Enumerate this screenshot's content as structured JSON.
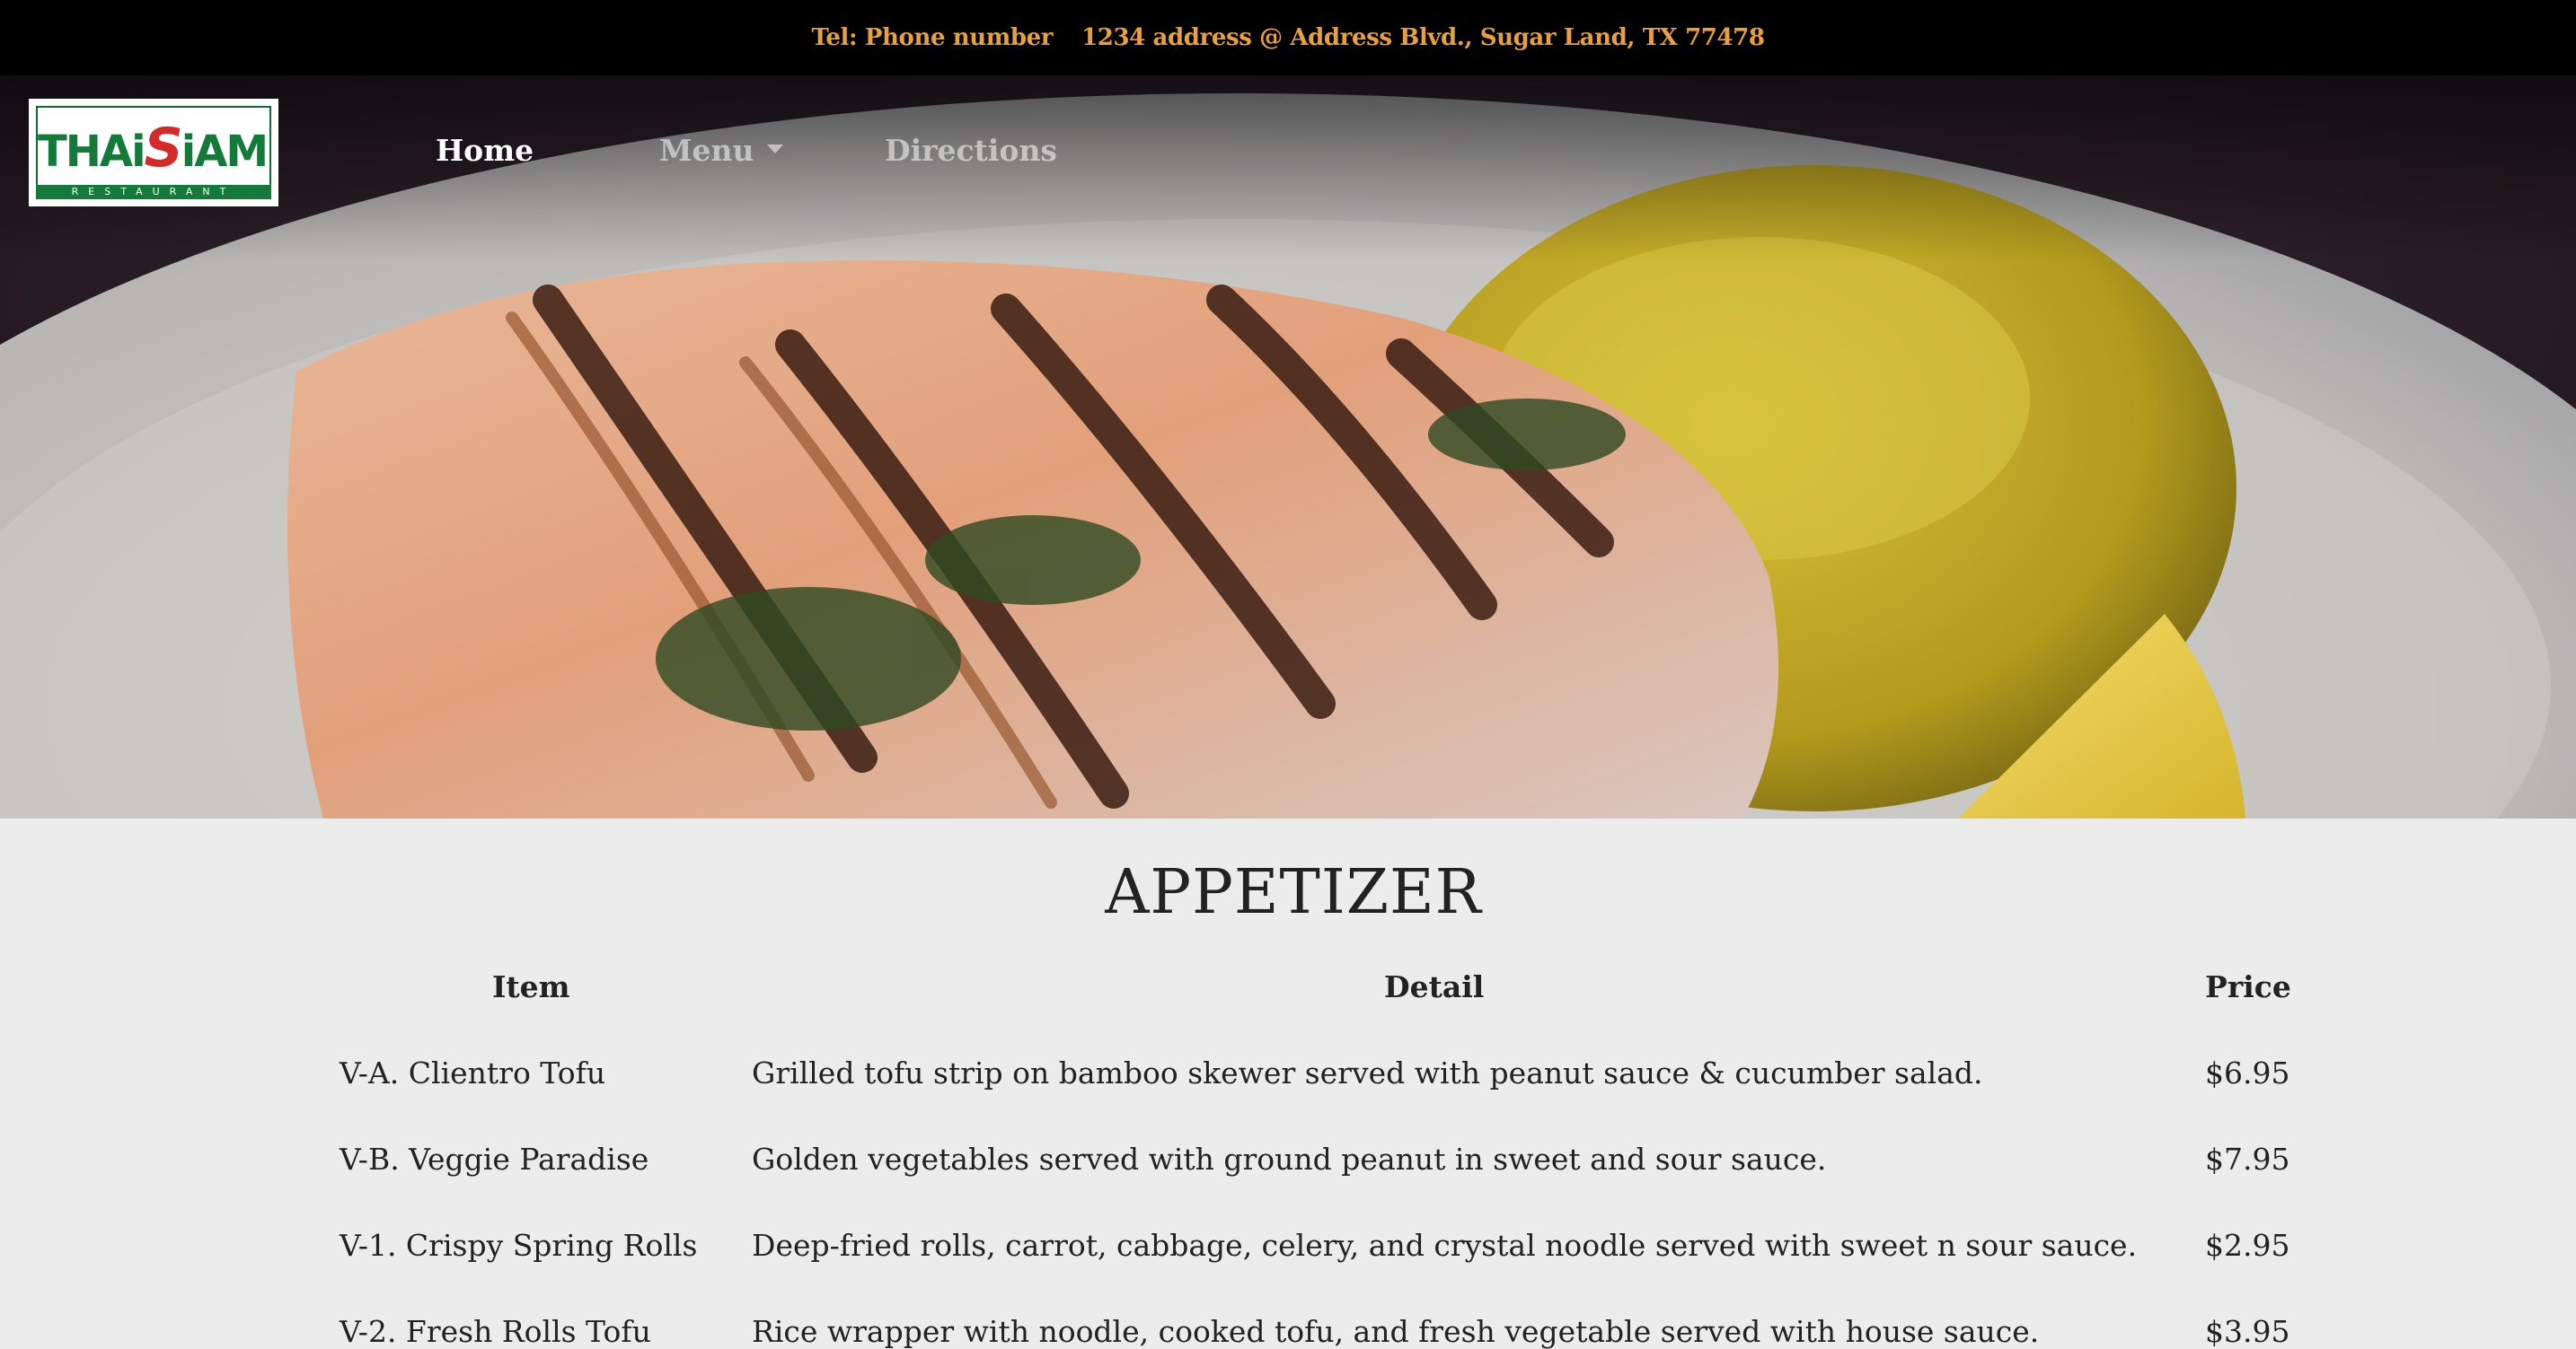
{
  "topbar": {
    "tel": "Tel: Phone number",
    "address": "1234 address @ Address Blvd., Sugar Land, TX 77478"
  },
  "nav": {
    "logo_word_left": "THAi",
    "logo_word_s": "S",
    "logo_word_right": "iAM",
    "logo_sub": "RESTAURANT",
    "home": "Home",
    "menu": "Menu",
    "directions": "Directions"
  },
  "section": {
    "title": "APPETIZER",
    "headers": {
      "item": "Item",
      "detail": "Detail",
      "price": "Price"
    },
    "rows": [
      {
        "item": "V-A. Clientro Tofu",
        "detail": "Grilled tofu strip on bamboo skewer served with peanut sauce & cucumber salad.",
        "price": "$6.95"
      },
      {
        "item": "V-B. Veggie Paradise",
        "detail": "Golden vegetables served with ground peanut in sweet and sour sauce.",
        "price": "$7.95"
      },
      {
        "item": "V-1. Crispy Spring Rolls",
        "detail": "Deep-fried rolls, carrot, cabbage, celery, and crystal noodle served with sweet n sour sauce.",
        "price": "$2.95"
      },
      {
        "item": "V-2. Fresh Rolls Tofu",
        "detail": "Rice wrapper with noodle, cooked tofu, and fresh vegetable served with house sauce.",
        "price": "$3.95"
      }
    ]
  },
  "colors": {
    "topbar_bg": "#000000",
    "topbar_text": "#e8a13a",
    "page_bg": "#ececec",
    "logo_green": "#137a3a",
    "logo_red": "#d42a2a"
  }
}
